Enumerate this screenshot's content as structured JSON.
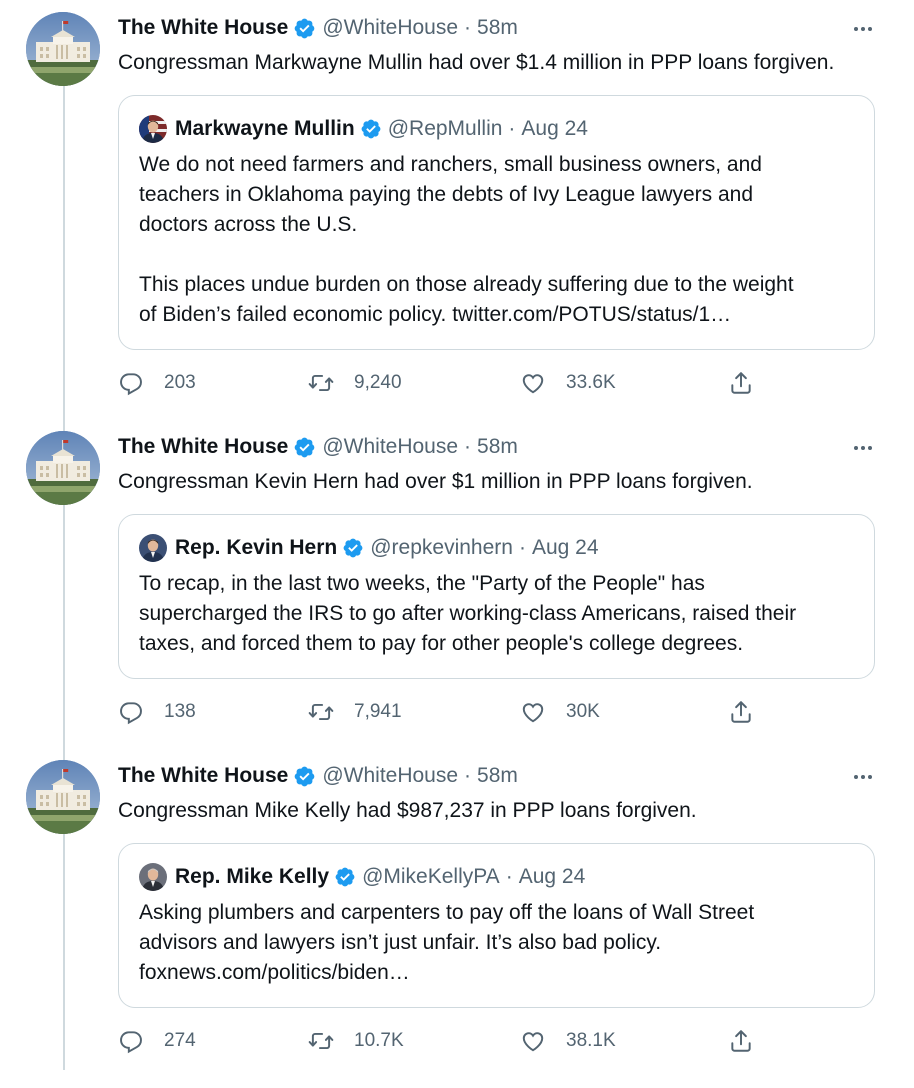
{
  "tweets": [
    {
      "author": "The White House",
      "handle": "@WhiteHouse",
      "separator": "·",
      "time": "58m",
      "text": "Congressman Markwayne Mullin had over $1.4 million in PPP loans forgiven.",
      "quote": {
        "author": "Markwayne Mullin",
        "handle": "@RepMullin",
        "separator": "·",
        "date": "Aug 24",
        "lines": [
          "We do not need farmers and ranchers, small business owners, and",
          "teachers in Oklahoma paying the debts of Ivy League lawyers and",
          "doctors across the U.S.",
          "",
          "This places undue burden on those already suffering due to the weight",
          "of Biden’s failed economic policy. twitter.com/POTUS/status/1…"
        ]
      },
      "stats": {
        "replies": "203",
        "retweets": "9,240",
        "likes": "33.6K"
      }
    },
    {
      "author": "The White House",
      "handle": "@WhiteHouse",
      "separator": "·",
      "time": "58m",
      "text": "Congressman Kevin Hern had over $1 million in PPP loans forgiven.",
      "quote": {
        "author": "Rep. Kevin Hern",
        "handle": "@repkevinhern",
        "separator": "·",
        "date": "Aug 24",
        "lines": [
          "To recap, in the last two weeks, the \"Party of the People\" has",
          "supercharged the IRS to go after working-class Americans, raised their",
          "taxes, and forced them to pay for other people's college degrees."
        ]
      },
      "stats": {
        "replies": "138",
        "retweets": "7,941",
        "likes": "30K"
      }
    },
    {
      "author": "The White House",
      "handle": "@WhiteHouse",
      "separator": "·",
      "time": "58m",
      "text": "Congressman Mike Kelly had $987,237 in PPP loans forgiven.",
      "quote": {
        "author": "Rep. Mike Kelly",
        "handle": "@MikeKellyPA",
        "separator": "·",
        "date": "Aug 24",
        "lines": [
          "Asking plumbers and carpenters to pay off the loans of Wall Street",
          "advisors and lawyers isn’t just unfair. It’s also bad policy.",
          "foxnews.com/politics/biden…"
        ]
      },
      "stats": {
        "replies": "274",
        "retweets": "10.7K",
        "likes": "38.1K"
      }
    }
  ],
  "icons": {
    "verified": "verified-badge-icon",
    "more": "more-options-icon",
    "reply": "reply-icon",
    "retweet": "retweet-icon",
    "like": "like-icon",
    "share": "share-icon"
  },
  "colors": {
    "verified": "#1d9bf0",
    "muted": "#536471",
    "border": "#cfd9de",
    "text": "#0f1419"
  }
}
